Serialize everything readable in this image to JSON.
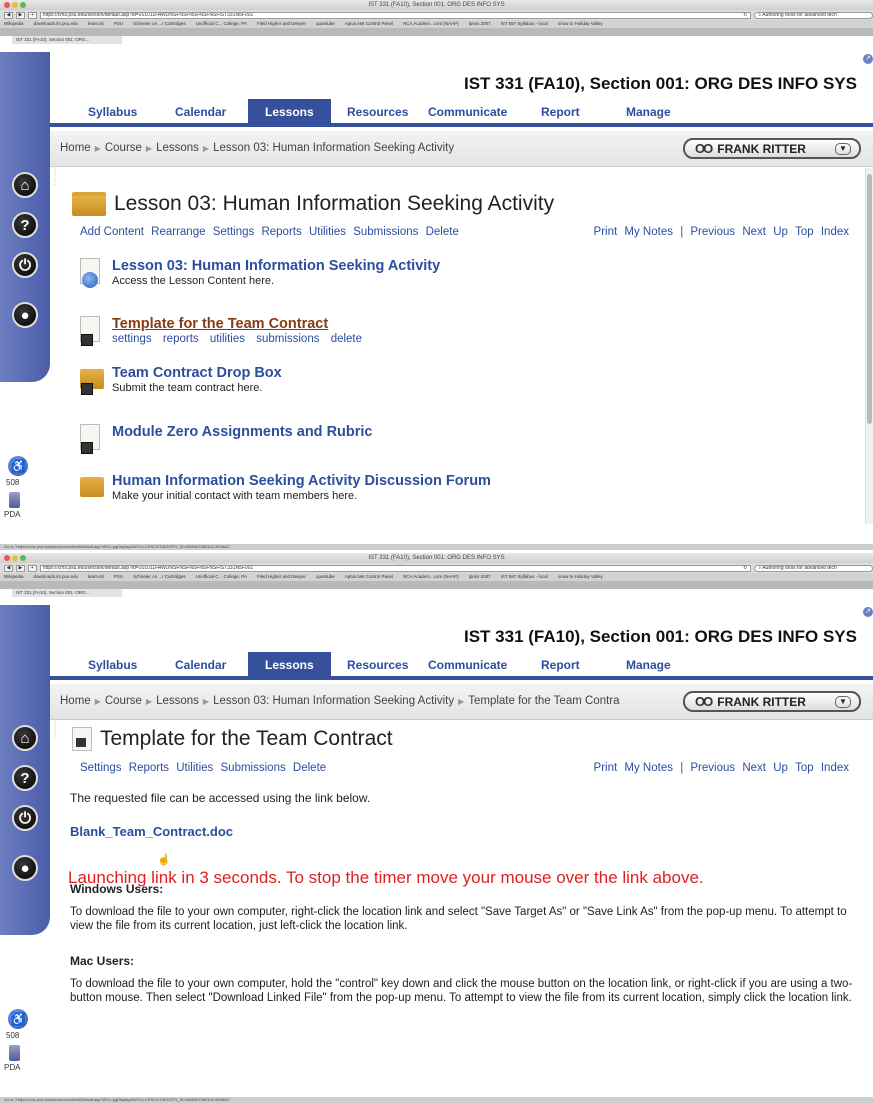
{
  "browser": {
    "window_title": "IST 331 (FA10), Section 001: ORG DES INFO SYS",
    "url_1": "https://cms.psu.edu/section/default.asp?id=201011FAWDNSFNSFNSFNSFNSFIST331N5F001",
    "url_2": "https://cms.psu.edu/section/default.asp?id=201011FAWDNSFNSFNSFNSFNSFIST331N5F001",
    "search_text": "Authoring tools for advanced tech",
    "bookmarks": [
      "Wikipedia",
      "downloads.its.psu.edu",
      "learn.ist",
      "PSU",
      "Schneier on ...r Cartridges",
      "Unofficial C... College, PA",
      "Filed Higher and Deeper",
      "quantube",
      "Aptus.Net Control Panel",
      "NCA Academ...com (NAAP)",
      "Ipmis 2007",
      "IST 597 Syllabus - local",
      "snow to Holiday Valley"
    ],
    "tab_label": "IST 331 (FA10), Section 001: ORG...",
    "status_1": "Go to \"https://cms.psu.edu/section/content/Default.asp?WCI=pgDisplay&WCU=CRSCNT&ENTRY_ID=6D89A738310C4FA8AC\"",
    "status_2": "Go to \"https://cms.psu.edu/section/content/Default.asp?WCI=pgDisplay&WCU=CRSCNT&ENTRY_ID=6D89A738310C4FA8AC\""
  },
  "course": {
    "title": "IST 331 (FA10), Section 001: ORG DES INFO SYS"
  },
  "nav": {
    "syllabus": "Syllabus",
    "calendar": "Calendar",
    "lessons": "Lessons",
    "resources": "Resources",
    "communicate": "Communicate",
    "report": "Report",
    "manage": "Manage"
  },
  "user": {
    "name": "FRANK RITTER",
    "glasses": "OO"
  },
  "sidebar": {
    "count": "508",
    "pda": "PDA"
  },
  "screen1": {
    "breadcrumb": [
      "Home",
      "Course",
      "Lessons",
      "Lesson 03: Human Information Seeking Activity"
    ],
    "heading": "Lesson 03: Human Information Seeking Activity",
    "actions": [
      "Add Content",
      "Rearrange",
      "Settings",
      "Reports",
      "Utilities",
      "Submissions",
      "Delete"
    ],
    "right_actions": [
      "Print",
      "My Notes",
      "|",
      "Previous",
      "Next",
      "Up",
      "Top",
      "Index"
    ],
    "items": [
      {
        "title": "Lesson 03: Human Information Seeking Activity",
        "desc": "Access the Lesson Content here."
      },
      {
        "title": "Template for the Team Contract",
        "links": [
          "settings",
          "reports",
          "utilities",
          "submissions",
          "delete"
        ]
      },
      {
        "title": "Team Contract Drop Box",
        "desc": "Submit the team contract here."
      },
      {
        "title": "Module Zero Assignments and Rubric"
      },
      {
        "title": "Human Information Seeking Activity Discussion Forum",
        "desc": "Make your initial contact with team members here."
      }
    ]
  },
  "screen2": {
    "breadcrumb": [
      "Home",
      "Course",
      "Lessons",
      "Lesson 03: Human Information Seeking Activity",
      "Template for the Team Contra"
    ],
    "heading": "Template for the Team Contract",
    "actions": [
      "Settings",
      "Reports",
      "Utilities",
      "Submissions",
      "Delete"
    ],
    "right_actions": [
      "Print",
      "My Notes",
      "|",
      "Previous",
      "Next",
      "Up",
      "Top",
      "Index"
    ],
    "intro": "The requested file can be accessed using the link below.",
    "file_link": "Blank_Team_Contract.doc",
    "launch_msg": "Launching link in 3 seconds. To stop the timer move your mouse over the link above.",
    "windows_title": "Windows Users:",
    "windows_text": "To download the file to your own computer, right-click the location link and select \"Save Target As\" or \"Save Link As\" from the pop-up menu. To attempt to view the file from its current location, just left-click the location link.",
    "mac_title": "Mac Users:",
    "mac_text": "To download the file to your own computer, hold the \"control\" key down and click the mouse button on the location link, or right-click if you are using a two-button mouse. Then select \"Download Linked File\" from the pop-up menu. To attempt to view the file from its current location, simply click the location link."
  }
}
